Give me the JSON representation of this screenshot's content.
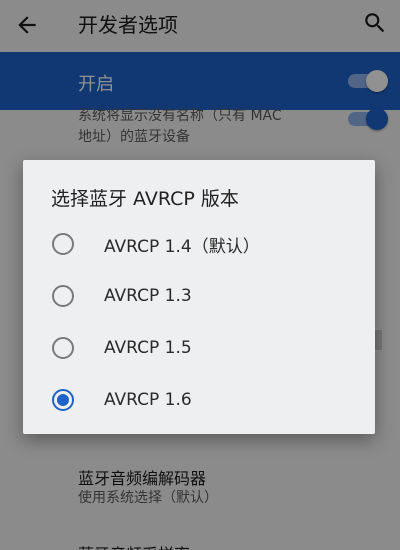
{
  "appbar": {
    "title": "开发者选项",
    "back_icon": "arrow-back-icon",
    "search_icon": "search-icon"
  },
  "master_switch": {
    "label": "开启",
    "checked": true
  },
  "settings": {
    "bt_no_name": {
      "desc_line1": "系统将显示没有名称（只有 MAC",
      "desc_line2": "地址）的蓝牙设备"
    },
    "bt_codec": {
      "title": "蓝牙音频编解码器",
      "summary": "使用系统选择（默认）"
    },
    "bt_sample_rate": {
      "title": "蓝牙音频采样率"
    }
  },
  "dialog": {
    "title": "选择蓝牙 AVRCP 版本",
    "options": [
      {
        "label": "AVRCP 1.4（默认）",
        "checked": false
      },
      {
        "label": "AVRCP 1.3",
        "checked": false
      },
      {
        "label": "AVRCP 1.5",
        "checked": false
      },
      {
        "label": "AVRCP 1.6",
        "checked": true
      }
    ]
  },
  "colors": {
    "accent": "#1f63c9",
    "scrim": "rgba(0,0,0,0.43)",
    "dialog_bg": "#eeeff0"
  }
}
